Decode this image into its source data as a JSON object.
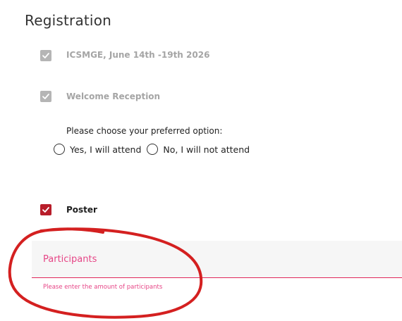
{
  "page": {
    "title": "Registration"
  },
  "options": [
    {
      "label": "ICSMGE, June 14th -19th 2026",
      "checked": true,
      "disabled": true,
      "icon": "checkmark-icon"
    },
    {
      "label": "Welcome Reception",
      "checked": true,
      "disabled": true,
      "icon": "checkmark-icon"
    },
    {
      "label": "Poster",
      "checked": true,
      "disabled": false,
      "icon": "checkmark-icon"
    }
  ],
  "reception": {
    "prompt": "Please choose your preferred option:",
    "radios": [
      {
        "label": "Yes, I will attend",
        "selected": false
      },
      {
        "label": "No, I will not attend",
        "selected": false
      }
    ]
  },
  "participants": {
    "label": "Participants",
    "hint": "Please enter the amount of participants",
    "value": ""
  },
  "colors": {
    "accent": "#b81d2a",
    "disabled": "#b5b5b5",
    "error": "#e64586",
    "annotation": "#d42020"
  }
}
